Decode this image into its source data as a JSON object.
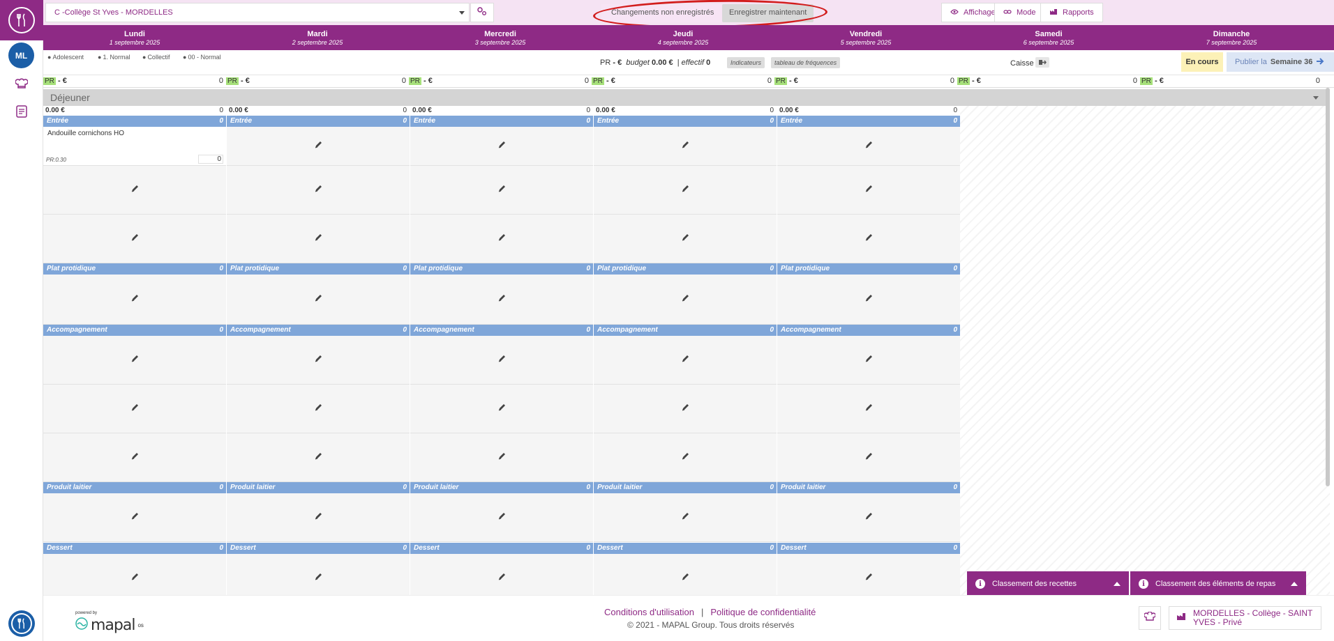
{
  "app": {
    "avatar_initials": "ML"
  },
  "topbar": {
    "site_name": "C -Collège St Yves - MORDELLES",
    "unsaved_label": "Changements non enregistrés",
    "save_now_label": "Enregistrer maintenant",
    "affichage_label": "Affichage",
    "mode_label": "Mode",
    "rapports_label": "Rapports"
  },
  "days": [
    {
      "name": "Lundi",
      "date": "1 septembre 2025"
    },
    {
      "name": "Mardi",
      "date": "2 septembre 2025"
    },
    {
      "name": "Mercredi",
      "date": "3 septembre 2025"
    },
    {
      "name": "Jeudi",
      "date": "4 septembre 2025"
    },
    {
      "name": "Vendredi",
      "date": "5 septembre 2025"
    },
    {
      "name": "Samedi",
      "date": "6 septembre 2025"
    },
    {
      "name": "Dimanche",
      "date": "7 septembre 2025"
    }
  ],
  "infobar": {
    "tags": [
      "Adolescent",
      "1. Normal",
      "Collectif",
      "00 - Normal"
    ],
    "pr_label": "PR",
    "pr_value": "-",
    "currency": "€",
    "budget_label": "budget",
    "budget_value": "0.00 €",
    "effectif_label": "effectif",
    "effectif_value": "0",
    "indicateurs_label": "Indicateurs",
    "frequences_label": "tableau de fréquences",
    "caisse_label": "Caisse",
    "status": "En cours",
    "publish_label": "Publier la",
    "week_label": "Semaine 36"
  },
  "pr_row": {
    "pr": "PR",
    "value": "- €",
    "count": "0"
  },
  "meal": {
    "name": "Déjeuner"
  },
  "columns_count": 5,
  "total": {
    "amount": "0.00 €",
    "count": "0"
  },
  "categories": [
    {
      "name": "Entrée",
      "count": "0"
    },
    {
      "name": "Plat protidique",
      "count": "0"
    },
    {
      "name": "Accompagnement",
      "count": "0"
    },
    {
      "name": "Produit laitier",
      "count": "0"
    },
    {
      "name": "Dessert",
      "count": "0"
    }
  ],
  "recipe": {
    "name": "Andouille cornichons HO",
    "pr": "PR:0.30",
    "qty": "0"
  },
  "footer": {
    "powered_by": "powered by",
    "brand": "mapal",
    "brand_suffix": "os",
    "terms": "Conditions d'utilisation",
    "separator": "|",
    "privacy": "Politique de confidentialité",
    "copyright": "© 2021 - MAPAL Group. Tous droits réservés",
    "site_label": "MORDELLES - Collège - SAINT YVES - Privé"
  },
  "drawers": {
    "recipes": "Classement des recettes",
    "elements": "Classement des éléments de repas"
  },
  "colors": {
    "brand": "#8e2a85",
    "category": "#7fa6d9",
    "pr_green": "#a6e07a",
    "annotation": "#d21d1d"
  }
}
